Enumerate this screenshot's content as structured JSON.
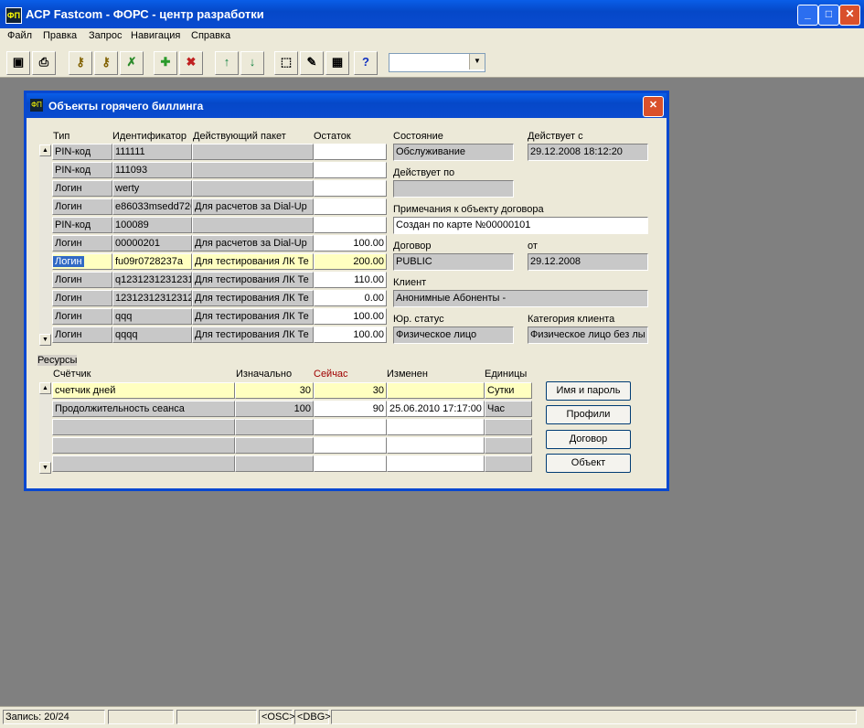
{
  "app": {
    "title": "АСР Fastcom - ФОРС - центр разработки",
    "icon_text": "ФП",
    "menu": [
      "Файл",
      "Правка",
      "Запрос",
      "Навигация",
      "Справка"
    ],
    "toolbar_icons": [
      "save-icon",
      "print-icon",
      "key-find-icon",
      "key-refresh-icon",
      "tools-icon",
      "add-icon",
      "delete-icon",
      "arrow-up-icon",
      "arrow-down-icon",
      "select-icon",
      "edit-icon",
      "grid-icon",
      "help-icon"
    ]
  },
  "dialog": {
    "title": "Объекты горячего биллинга",
    "objects": {
      "headers": [
        "Тип",
        "Идентификатор",
        "Действующий пакет",
        "Остаток"
      ],
      "rows": [
        {
          "type": "PIN-код",
          "id": "111111",
          "package": "",
          "balance": ""
        },
        {
          "type": "PIN-код",
          "id": "111093",
          "package": "",
          "balance": ""
        },
        {
          "type": "Логин",
          "id": "werty",
          "package": "",
          "balance": ""
        },
        {
          "type": "Логин",
          "id": "e86033msedd726",
          "package": "Для расчетов за Dial-Up",
          "balance": ""
        },
        {
          "type": "PIN-код",
          "id": "100089",
          "package": "",
          "balance": ""
        },
        {
          "type": "Логин",
          "id": "00000201",
          "package": "Для расчетов за Dial-Up",
          "balance": "100.00"
        },
        {
          "type": "Логин",
          "id": "fu09r0728237a",
          "package": "Для тестирования ЛК Те",
          "balance": "200.00"
        },
        {
          "type": "Логин",
          "id": "q1231231231231",
          "package": "Для тестирования ЛК Те",
          "balance": "110.00"
        },
        {
          "type": "Логин",
          "id": "12312312312312",
          "package": "Для тестирования ЛК Те",
          "balance": "0.00"
        },
        {
          "type": "Логин",
          "id": "qqq",
          "package": "Для тестирования ЛК Те",
          "balance": "100.00"
        },
        {
          "type": "Логин",
          "id": "qqqq",
          "package": "Для тестирования ЛК Те",
          "balance": "100.00"
        }
      ]
    },
    "details": {
      "state_label": "Состояние",
      "state": "Обслуживание",
      "valid_from_label": "Действует с",
      "valid_from": "29.12.2008 18:12:20",
      "valid_to_label": "Действует по",
      "valid_to": "",
      "notes_label": "Примечания к объекту договора",
      "notes": "Создан по карте №00000101",
      "contract_label": "Договор",
      "contract": "PUBLIC",
      "from_label": "от",
      "from": "29.12.2008",
      "client_label": "Клиент",
      "client": "Анонимные Абоненты -",
      "legal_label": "Юр. статус",
      "legal": "Физическое лицо",
      "category_label": "Категория клиента",
      "category": "Физическое лицо без лы"
    },
    "resources": {
      "section_label": "Ресурсы",
      "headers": [
        "Счётчик",
        "Изначально",
        "Сейчас",
        "Изменен",
        "Единицы"
      ],
      "rows": [
        {
          "counter": "счетчик дней",
          "initial": "30",
          "current": "30",
          "changed": "",
          "unit": "Сутки"
        },
        {
          "counter": "Продолжительность сеанса",
          "initial": "100",
          "current": "90",
          "changed": "25.06.2010 17:17:00",
          "unit": "Час"
        }
      ]
    },
    "buttons": [
      "Имя и пароль",
      "Профили",
      "Договор",
      "Объект"
    ]
  },
  "status": {
    "record": "Запись: 20/24",
    "osc": "<OSC>",
    "dbg": "<DBG>"
  },
  "colors": {
    "titlebar": "#0548c8",
    "dialog_bg": "#ece9d8",
    "desktop": "#808080",
    "selected": "#316ac5",
    "highlight_row": "#ffffc0"
  }
}
